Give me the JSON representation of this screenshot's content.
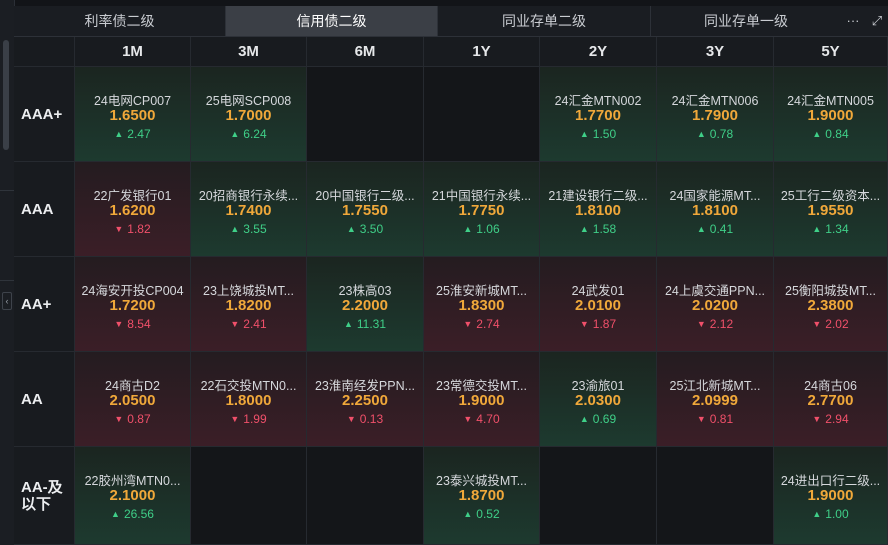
{
  "tabs": [
    {
      "label": "利率债二级",
      "active": false
    },
    {
      "label": "信用债二级",
      "active": true
    },
    {
      "label": "同业存单二级",
      "active": false
    },
    {
      "label": "同业存单一级",
      "active": false
    }
  ],
  "tab_tools": {
    "more": "···",
    "expand": "⤢"
  },
  "columns": [
    "1M",
    "3M",
    "6M",
    "1Y",
    "2Y",
    "3Y",
    "5Y"
  ],
  "rows": [
    {
      "label": "AAA+",
      "cells": [
        {
          "name": "24电网CP007",
          "yield": "1.6500",
          "change": "2.47",
          "dir": "up"
        },
        {
          "name": "25电网SCP008",
          "yield": "1.7000",
          "change": "6.24",
          "dir": "up"
        },
        null,
        null,
        {
          "name": "24汇金MTN002",
          "yield": "1.7700",
          "change": "1.50",
          "dir": "up"
        },
        {
          "name": "24汇金MTN006",
          "yield": "1.7900",
          "change": "0.78",
          "dir": "up"
        },
        {
          "name": "24汇金MTN005",
          "yield": "1.9000",
          "change": "0.84",
          "dir": "up"
        }
      ]
    },
    {
      "label": "AAA",
      "cells": [
        {
          "name": "22广发银行01",
          "yield": "1.6200",
          "change": "1.82",
          "dir": "down"
        },
        {
          "name": "20招商银行永续...",
          "yield": "1.7400",
          "change": "3.55",
          "dir": "up"
        },
        {
          "name": "20中国银行二级...",
          "yield": "1.7550",
          "change": "3.50",
          "dir": "up"
        },
        {
          "name": "21中国银行永续...",
          "yield": "1.7750",
          "change": "1.06",
          "dir": "up"
        },
        {
          "name": "21建设银行二级...",
          "yield": "1.8100",
          "change": "1.58",
          "dir": "up"
        },
        {
          "name": "24国家能源MT...",
          "yield": "1.8100",
          "change": "0.41",
          "dir": "up"
        },
        {
          "name": "25工行二级资本...",
          "yield": "1.9550",
          "change": "1.34",
          "dir": "up"
        }
      ]
    },
    {
      "label": "AA+",
      "cells": [
        {
          "name": "24海安开投CP004",
          "yield": "1.7200",
          "change": "8.54",
          "dir": "down"
        },
        {
          "name": "23上饶城投MT...",
          "yield": "1.8200",
          "change": "2.41",
          "dir": "down"
        },
        {
          "name": "23株高03",
          "yield": "2.2000",
          "change": "11.31",
          "dir": "up"
        },
        {
          "name": "25淮安新城MT...",
          "yield": "1.8300",
          "change": "2.74",
          "dir": "down"
        },
        {
          "name": "24武发01",
          "yield": "2.0100",
          "change": "1.87",
          "dir": "down"
        },
        {
          "name": "24上虞交通PPN...",
          "yield": "2.0200",
          "change": "2.12",
          "dir": "down"
        },
        {
          "name": "25衡阳城投MT...",
          "yield": "2.3800",
          "change": "2.02",
          "dir": "down"
        }
      ]
    },
    {
      "label": "AA",
      "cells": [
        {
          "name": "24商古D2",
          "yield": "2.0500",
          "change": "0.87",
          "dir": "down"
        },
        {
          "name": "22石交投MTN0...",
          "yield": "1.8000",
          "change": "1.99",
          "dir": "down"
        },
        {
          "name": "23淮南经发PPN...",
          "yield": "2.2500",
          "change": "0.13",
          "dir": "down"
        },
        {
          "name": "23常德交投MT...",
          "yield": "1.9000",
          "change": "4.70",
          "dir": "down"
        },
        {
          "name": "23渝旅01",
          "yield": "2.0300",
          "change": "0.69",
          "dir": "up"
        },
        {
          "name": "25江北新城MT...",
          "yield": "2.0999",
          "change": "0.81",
          "dir": "down"
        },
        {
          "name": "24商古06",
          "yield": "2.7700",
          "change": "2.94",
          "dir": "down"
        }
      ]
    },
    {
      "label": "AA-及以下",
      "cells": [
        {
          "name": "22胶州湾MTN0...",
          "yield": "2.1000",
          "change": "26.56",
          "dir": "up"
        },
        null,
        null,
        {
          "name": "23泰兴城投MT...",
          "yield": "1.8700",
          "change": "0.52",
          "dir": "up"
        },
        null,
        null,
        {
          "name": "24进出口行二级...",
          "yield": "1.9000",
          "change": "1.00",
          "dir": "up"
        }
      ]
    }
  ]
}
